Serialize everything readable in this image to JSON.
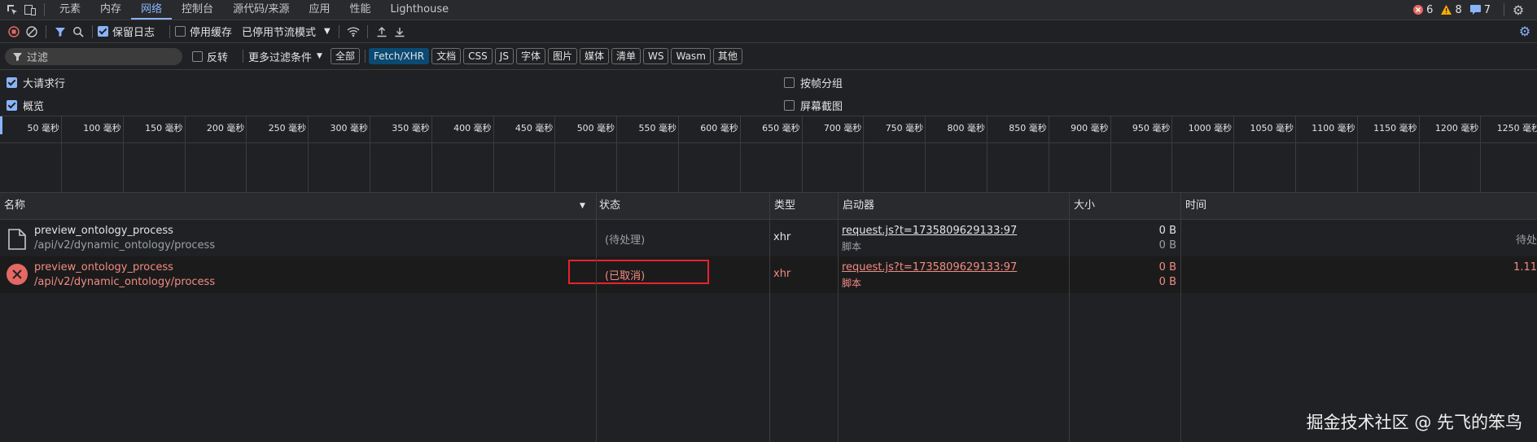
{
  "tabs": [
    "元素",
    "内存",
    "网络",
    "控制台",
    "源代码/来源",
    "应用",
    "性能",
    "Lighthouse"
  ],
  "active_tab_index": 2,
  "counts": {
    "errors": "6",
    "warnings": "8",
    "messages": "7"
  },
  "toolbar": {
    "preserve_log": "保留日志",
    "disable_cache": "停用缓存",
    "throttle": "已停用节流模式"
  },
  "filter": {
    "placeholder": "过滤",
    "invert": "反转",
    "more": "更多过滤条件"
  },
  "types": [
    "全部",
    "Fetch/XHR",
    "文档",
    "CSS",
    "JS",
    "字体",
    "图片",
    "媒体",
    "清单",
    "WS",
    "Wasm",
    "其他"
  ],
  "selected_type": "Fetch/XHR",
  "options": {
    "big_rows": "大请求行",
    "overview": "概览",
    "group_by_frame": "按帧分组",
    "screenshots": "屏幕截图"
  },
  "timeline_ticks": [
    "50 毫秒",
    "100 毫秒",
    "150 毫秒",
    "200 毫秒",
    "250 毫秒",
    "300 毫秒",
    "350 毫秒",
    "400 毫秒",
    "450 毫秒",
    "500 毫秒",
    "550 毫秒",
    "600 毫秒",
    "650 毫秒",
    "700 毫秒",
    "750 毫秒",
    "800 毫秒",
    "850 毫秒",
    "900 毫秒",
    "950 毫秒",
    "1000 毫秒",
    "1050 毫秒",
    "1100 毫秒",
    "1150 毫秒",
    "1200 毫秒",
    "1250 毫秒"
  ],
  "columns": {
    "name": "名称",
    "status": "状态",
    "type": "类型",
    "initiator": "启动器",
    "size": "大小",
    "time": "时间"
  },
  "rows": [
    {
      "name": "preview_ontology_process",
      "path": "/api/v2/dynamic_ontology/process",
      "status": "(待处理)",
      "type": "xhr",
      "initiator": "request.js?t=1735809629133:97",
      "initiator_type": "脚本",
      "size1": "0 B",
      "size2": "0 B",
      "time": "待处"
    },
    {
      "name": "preview_ontology_process",
      "path": "/api/v2/dynamic_ontology/process",
      "status": "(已取消)",
      "type": "xhr",
      "initiator": "request.js?t=1735809629133:97",
      "initiator_type": "脚本",
      "size1": "0 B",
      "size2": "0 B",
      "time": "1.11"
    }
  ],
  "watermark": "掘金技术社区 @ 先飞的笨鸟",
  "colors": {
    "accent": "#8ab4f8",
    "error": "#f28b82",
    "highlight_box": "#e8232d"
  }
}
